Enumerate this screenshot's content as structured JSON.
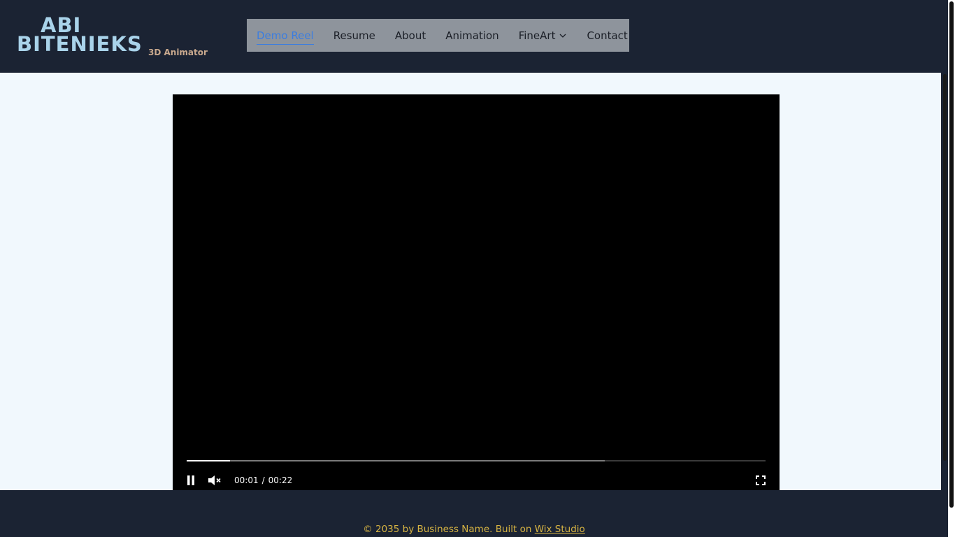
{
  "logo": {
    "line1": "ABI",
    "line2": "BITENIEKS",
    "subtitle": "3D Animator"
  },
  "nav": {
    "items": [
      {
        "label": "Demo Reel",
        "active": true
      },
      {
        "label": "Resume"
      },
      {
        "label": "About"
      },
      {
        "label": "Animation"
      },
      {
        "label": "FineArt",
        "has_dropdown": true
      },
      {
        "label": "Contact"
      }
    ]
  },
  "video": {
    "current_time": "00:01",
    "separator": "/",
    "duration": "00:22",
    "played_fraction": 0.075,
    "buffered_fraction": 0.722,
    "state": "playing",
    "muted": true,
    "icons": {
      "pause": "pause-icon",
      "mute": "volume-muted-icon",
      "fullscreen": "fullscreen-icon"
    }
  },
  "footer": {
    "text": "© 2035 by Business Name. Built on ",
    "link": "Wix Studio"
  },
  "colors": {
    "header_bg": "#1b2333",
    "nav_bg": "#8e949c",
    "nav_active": "#3b7de0",
    "page_bg": "#f1f8fd",
    "footer_text": "#d7b443",
    "logo_text": "#a9d3ea",
    "logo_sub": "#c9a98e"
  }
}
